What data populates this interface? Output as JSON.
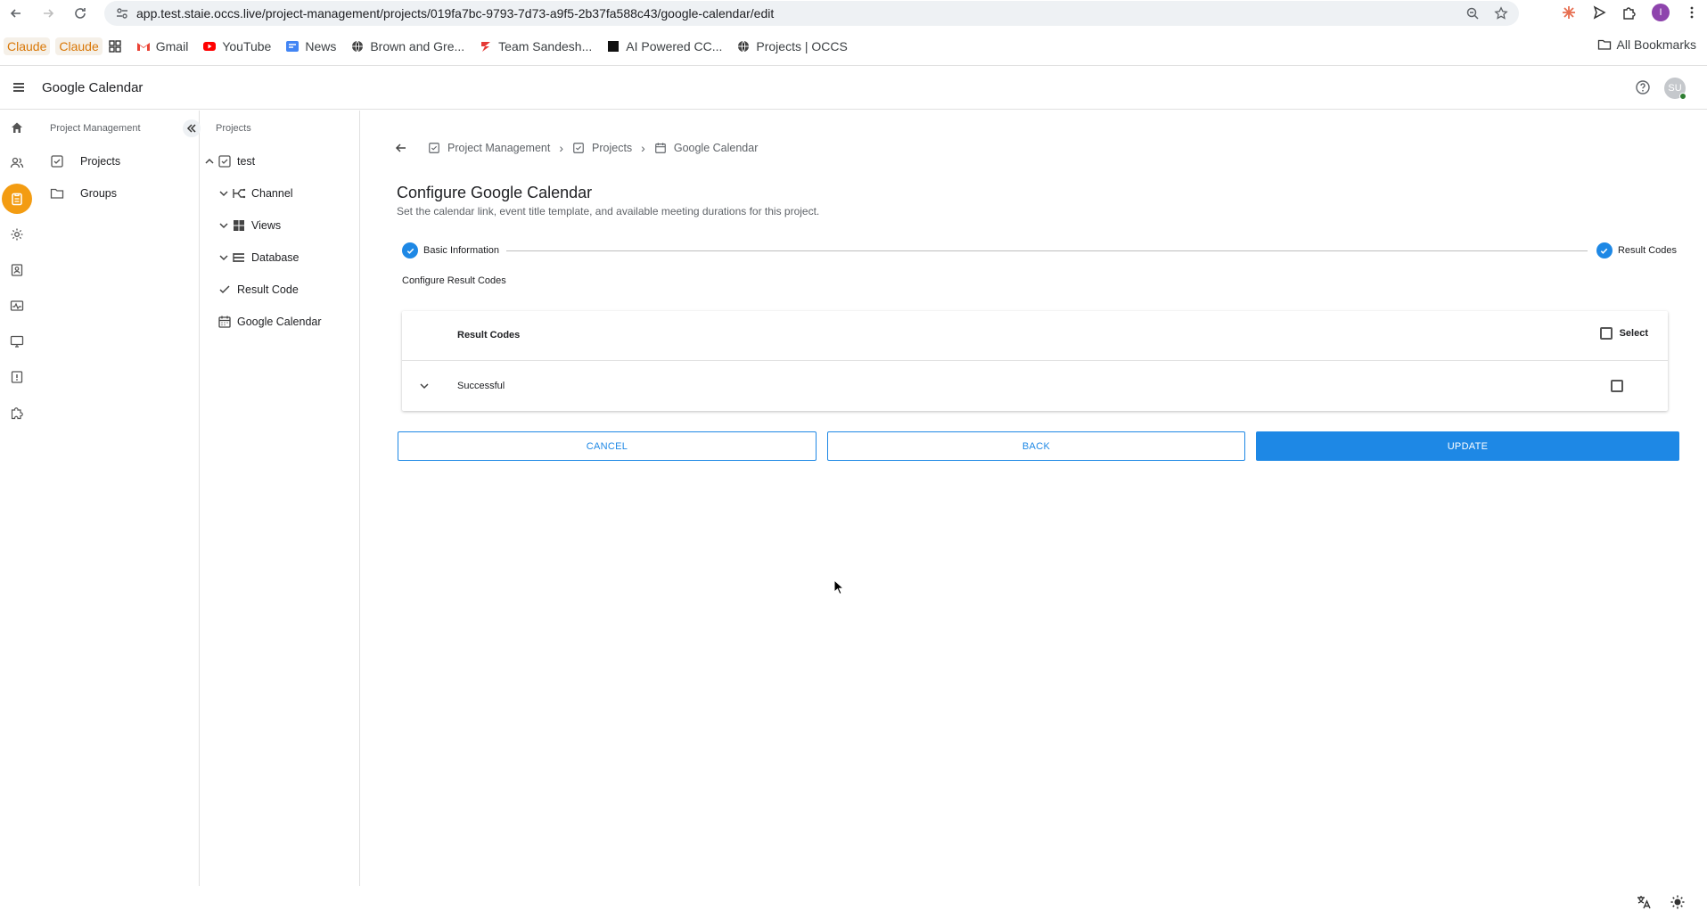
{
  "browser": {
    "url": "app.test.staie.occs.live/project-management/projects/019fa7bc-9793-7d73-a9f5-2b37fa588c43/google-calendar/edit",
    "profile_initial": "I",
    "bookmarks": [
      {
        "label": "Claude",
        "icon": "claude-icon"
      },
      {
        "label": "Claude",
        "icon": "claude-icon"
      },
      {
        "label": "",
        "icon": "apps-grid-icon"
      },
      {
        "label": "Gmail",
        "icon": "gmail-icon"
      },
      {
        "label": "YouTube",
        "icon": "youtube-icon"
      },
      {
        "label": "News",
        "icon": "news-icon"
      },
      {
        "label": "Brown and Gre...",
        "icon": "globe-icon"
      },
      {
        "label": "Team Sandesh...",
        "icon": "team-icon"
      },
      {
        "label": "AI Powered CC...",
        "icon": "ai-icon"
      },
      {
        "label": "Projects | OCCS",
        "icon": "globe-icon"
      }
    ],
    "all_bookmarks": "All Bookmarks"
  },
  "app": {
    "title": "Google Calendar",
    "avatar_initials": "SU"
  },
  "panel1": {
    "header": "Project Management",
    "items": [
      {
        "label": "Projects",
        "icon": "checkbox-icon"
      },
      {
        "label": "Groups",
        "icon": "folder-icon"
      }
    ]
  },
  "panel2": {
    "header": "Projects",
    "project": "test",
    "items": [
      {
        "label": "Channel",
        "icon": "channel-icon"
      },
      {
        "label": "Views",
        "icon": "grid-icon"
      },
      {
        "label": "Database",
        "icon": "database-icon"
      },
      {
        "label": "Result Code",
        "icon": "check-icon"
      },
      {
        "label": "Google Calendar",
        "icon": "calendar-icon"
      }
    ]
  },
  "breadcrumb": [
    {
      "label": "Project Management"
    },
    {
      "label": "Projects"
    },
    {
      "label": "Google Calendar"
    }
  ],
  "page": {
    "title": "Configure Google Calendar",
    "subtitle": "Set the calendar link, event title template, and available meeting durations for this project.",
    "section_label": "Configure Result Codes"
  },
  "stepper": {
    "steps": [
      "Basic Information",
      "Result Codes"
    ]
  },
  "result_codes": {
    "header": "Result Codes",
    "select_label": "Select",
    "rows": [
      {
        "name": "Successful",
        "checked": false
      }
    ]
  },
  "actions": {
    "cancel": "CANCEL",
    "back": "BACK",
    "update": "UPDATE"
  },
  "colors": {
    "accent": "#1e88e5",
    "rail_active": "#f39c12"
  }
}
